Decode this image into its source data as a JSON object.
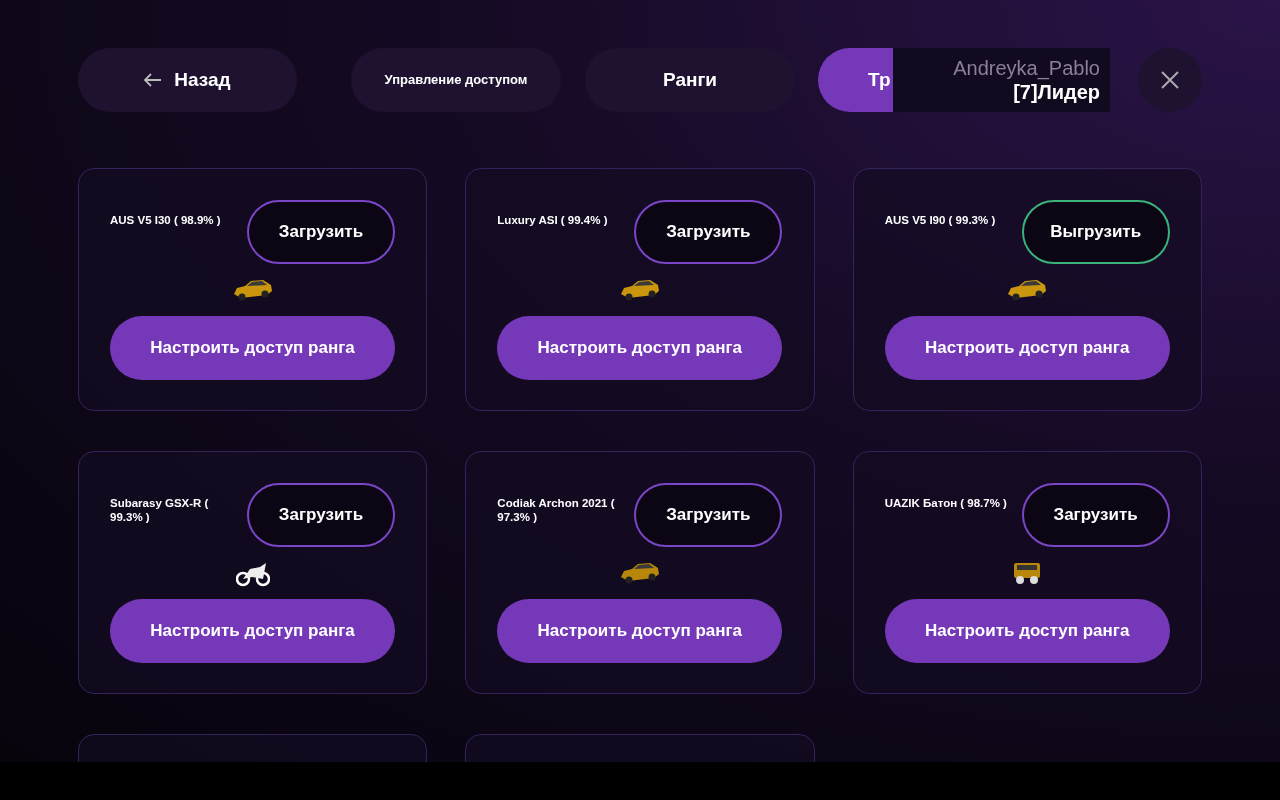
{
  "back_button": {
    "label": "Назад"
  },
  "tabs": [
    {
      "label": "Управление доступом",
      "selected": false
    },
    {
      "label": "Ранги",
      "selected": false
    },
    {
      "label": "Тр",
      "selected": true
    }
  ],
  "user": {
    "name": "Andreyka_Pablo",
    "rank": "[7]Лидер"
  },
  "cards": [
    {
      "kind": "car",
      "name": "AUS V5 I30 ( 98.9% )",
      "loaded": false,
      "toggle_label": "Загрузить",
      "access_label": "Настроить доступ ранга"
    },
    {
      "kind": "car",
      "name": "Luxury ASI ( 99.4% )",
      "loaded": false,
      "toggle_label": "Загрузить",
      "access_label": "Настроить доступ ранга"
    },
    {
      "kind": "car",
      "name": "AUS V5 I90 ( 99.3% )",
      "loaded": true,
      "toggle_label": "Выгрузить",
      "access_label": "Настроить доступ ранга"
    },
    {
      "kind": "motorcycle",
      "name": "Subarasy GSX-R ( 99.3% )",
      "loaded": false,
      "toggle_label": "Загрузить",
      "access_label": "Настроить доступ ранга"
    },
    {
      "kind": "suv",
      "name": "Codiak Archon 2021 ( 97.3% )",
      "loaded": false,
      "toggle_label": "Загрузить",
      "access_label": "Настроить доступ ранга"
    },
    {
      "kind": "van",
      "name": "UAZIK Батон ( 98.7% )",
      "loaded": false,
      "toggle_label": "Загрузить",
      "access_label": "Настроить доступ ранга"
    },
    {
      "kind": "cut"
    },
    {
      "kind": "cut"
    }
  ]
}
